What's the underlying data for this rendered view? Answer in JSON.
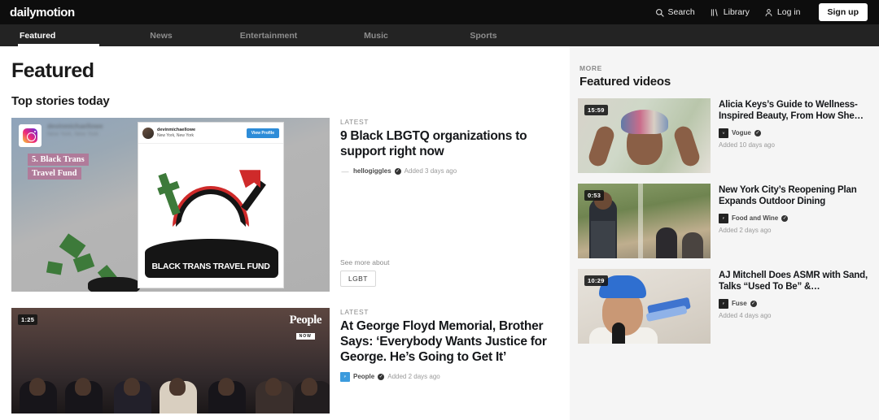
{
  "brand": {
    "logo": "dailymotion"
  },
  "topnav": {
    "items": [
      {
        "label": "Search",
        "icon": "search-icon"
      },
      {
        "label": "Library",
        "icon": "library-icon"
      },
      {
        "label": "Log in",
        "icon": "user-icon"
      }
    ],
    "signup_label": "Sign up"
  },
  "categories": [
    {
      "label": "Featured",
      "active": true
    },
    {
      "label": "News",
      "active": false
    },
    {
      "label": "Entertainment",
      "active": false
    },
    {
      "label": "Music",
      "active": false
    },
    {
      "label": "Sports",
      "active": false
    }
  ],
  "main": {
    "page_title": "Featured",
    "section_title": "Top stories today",
    "stories": [
      {
        "label": "LATEST",
        "headline": "9 Black LBGTQ organizations to support right now",
        "channel": "hellogiggles",
        "added": "Added 3 days ago",
        "verified": "✓",
        "see_more_label": "See more about",
        "tag": "LGBT",
        "thumb": {
          "kind": "instagram-post",
          "overlay_line1": "5. Black Trans",
          "overlay_line2": "Travel Fund",
          "ig_user": "devinmichaellowe",
          "ig_location": "New York, New York",
          "view_profile": "View Profile",
          "art_text": "BLACK TRANS TRAVEL FUND"
        }
      },
      {
        "label": "LATEST",
        "headline": "At George Floyd Memorial, Brother Says: ‘Everybody Wants Justice for George. He’s Going to Get It’",
        "channel": "People",
        "added": "Added 2 days ago",
        "verified": "✓",
        "duration": "1:25",
        "thumb": {
          "kind": "memorial-video",
          "watermark_main": "People",
          "watermark_sub": "NOW"
        }
      }
    ]
  },
  "sidebar": {
    "more_label": "MORE",
    "title": "Featured videos",
    "videos": [
      {
        "duration": "15:59",
        "title": "Alicia Keys’s Guide to Wellness-Inspired Beauty, From How She…",
        "channel": "Vogue",
        "verified": "✓",
        "added": "Added 10 days ago"
      },
      {
        "duration": "0:53",
        "title": "New York City’s Reopening Plan Expands Outdoor Dining",
        "channel": "Food and Wine",
        "verified": "✓",
        "added": "Added 2 days ago"
      },
      {
        "duration": "10:29",
        "title": "AJ Mitchell Does ASMR with Sand, Talks “Used To Be” &…",
        "channel": "Fuse",
        "verified": "✓",
        "added": "Added 4 days ago"
      }
    ]
  },
  "colors": {
    "header_bg": "#0d0d0d",
    "nav_bg": "#232323",
    "sidebar_bg": "#f5f5f5",
    "accent_white": "#ffffff",
    "text_dark": "#15171a",
    "muted": "#9a9a9a"
  }
}
